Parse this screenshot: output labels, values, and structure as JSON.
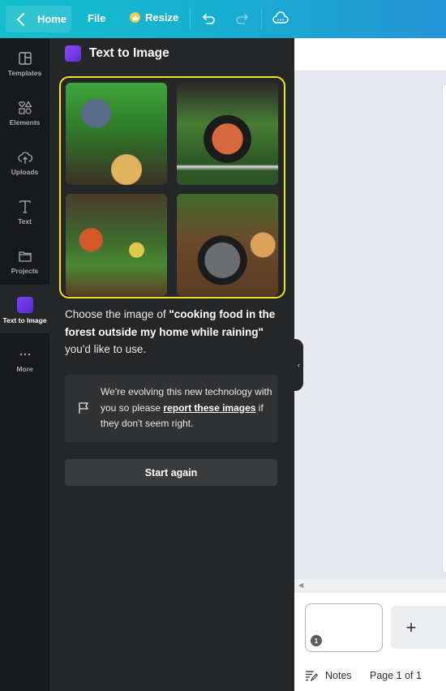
{
  "topbar": {
    "home_label": "Home",
    "file_label": "File",
    "resize_label": "Resize",
    "icons": [
      "chevron-left-icon",
      "crown-icon",
      "undo-icon",
      "redo-icon",
      "cloud-sync-icon"
    ]
  },
  "sidebar": {
    "items": [
      {
        "label": "Templates",
        "icon": "templates-icon"
      },
      {
        "label": "Elements",
        "icon": "elements-icon"
      },
      {
        "label": "Uploads",
        "icon": "upload-cloud-icon"
      },
      {
        "label": "Text",
        "icon": "text-icon"
      },
      {
        "label": "Projects",
        "icon": "folder-icon"
      },
      {
        "label": "Text to Image",
        "icon": "text-to-image-icon",
        "active": true
      },
      {
        "label": "More",
        "icon": "more-dots-icon"
      }
    ]
  },
  "panel": {
    "title": "Text to Image",
    "images": [
      {
        "alt": "Person cooking on a camp stove in the forest"
      },
      {
        "alt": "Hands cooking in a pan on a stove in the forest"
      },
      {
        "alt": "Illustrated man cooking food in the forest"
      },
      {
        "alt": "Smoking wok with food on forest floor"
      }
    ],
    "selection_color": "#f1e421",
    "desc_prefix": "Choose the image of ",
    "desc_prompt": "\"cooking food in the forest outside my home while raining\"",
    "desc_suffix": " you'd like to use.",
    "notice_prefix": "We're evolving this new technology with you so please ",
    "notice_link": "report these images",
    "notice_suffix": " if they don't seem right.",
    "start_again_label": "Start again"
  },
  "editor": {
    "page_number": "1",
    "add_page_label": "+",
    "notes_label": "Notes",
    "page_info": "Page 1 of 1"
  }
}
